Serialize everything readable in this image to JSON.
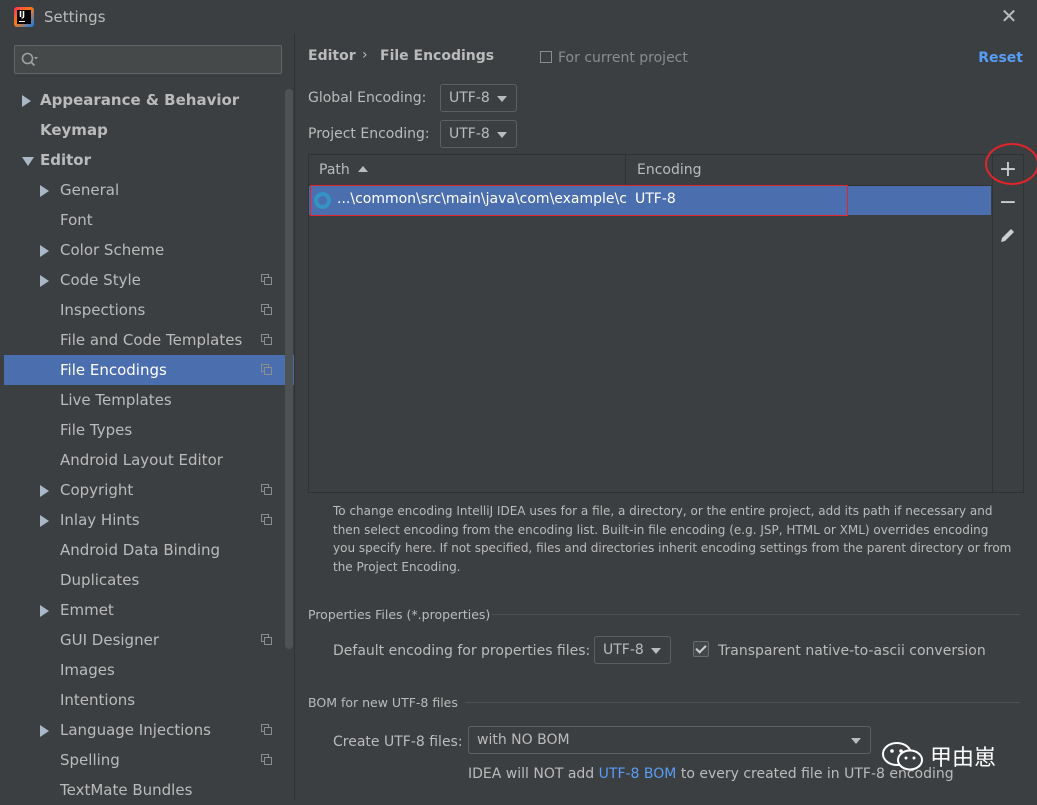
{
  "window": {
    "title": "Settings",
    "close_icon": "close-icon"
  },
  "search": {
    "placeholder": "",
    "value": ""
  },
  "sidebar": {
    "items": [
      {
        "label": "Appearance & Behavior",
        "level": 0,
        "arrow": "right",
        "bold": true
      },
      {
        "label": "Keymap",
        "level": 0,
        "arrow": "none",
        "bold": true
      },
      {
        "label": "Editor",
        "level": 0,
        "arrow": "down",
        "bold": true
      },
      {
        "label": "General",
        "level": 1,
        "arrow": "right"
      },
      {
        "label": "Font",
        "level": 1,
        "arrow": "none"
      },
      {
        "label": "Color Scheme",
        "level": 1,
        "arrow": "right"
      },
      {
        "label": "Code Style",
        "level": 1,
        "arrow": "right",
        "project": true
      },
      {
        "label": "Inspections",
        "level": 1,
        "arrow": "none",
        "project": true
      },
      {
        "label": "File and Code Templates",
        "level": 1,
        "arrow": "none",
        "project": true
      },
      {
        "label": "File Encodings",
        "level": 1,
        "arrow": "none",
        "project": true,
        "selected": true
      },
      {
        "label": "Live Templates",
        "level": 1,
        "arrow": "none"
      },
      {
        "label": "File Types",
        "level": 1,
        "arrow": "none"
      },
      {
        "label": "Android Layout Editor",
        "level": 1,
        "arrow": "none"
      },
      {
        "label": "Copyright",
        "level": 1,
        "arrow": "right",
        "project": true
      },
      {
        "label": "Inlay Hints",
        "level": 1,
        "arrow": "right",
        "project": true
      },
      {
        "label": "Android Data Binding",
        "level": 1,
        "arrow": "none"
      },
      {
        "label": "Duplicates",
        "level": 1,
        "arrow": "none"
      },
      {
        "label": "Emmet",
        "level": 1,
        "arrow": "right"
      },
      {
        "label": "GUI Designer",
        "level": 1,
        "arrow": "none",
        "project": true
      },
      {
        "label": "Images",
        "level": 1,
        "arrow": "none"
      },
      {
        "label": "Intentions",
        "level": 1,
        "arrow": "none"
      },
      {
        "label": "Language Injections",
        "level": 1,
        "arrow": "right",
        "project": true
      },
      {
        "label": "Spelling",
        "level": 1,
        "arrow": "none",
        "project": true
      },
      {
        "label": "TextMate Bundles",
        "level": 1,
        "arrow": "none"
      }
    ]
  },
  "header": {
    "breadcrumb_parent": "Editor",
    "breadcrumb_sep": "›",
    "breadcrumb_current": "File Encodings",
    "scope": "For current project",
    "reset": "Reset"
  },
  "global_encoding": {
    "label": "Global Encoding:",
    "value": "UTF-8"
  },
  "project_encoding": {
    "label": "Project Encoding:",
    "value": "UTF-8"
  },
  "table": {
    "columns": [
      "Path",
      "Encoding"
    ],
    "rows": [
      {
        "path": "...\\common\\src\\main\\java\\com\\example\\cc",
        "encoding": "UTF-8"
      }
    ],
    "tools": {
      "add": "+",
      "remove": "−",
      "edit_icon": "pencil-icon"
    }
  },
  "help_text": "To change encoding IntelliJ IDEA uses for a file, a directory, or the entire project, add its path if necessary and then select encoding from the encoding list. Built-in file encoding (e.g. JSP, HTML or XML) overrides encoding you specify here. If not specified, files and directories inherit encoding settings from the parent directory or from the Project Encoding.",
  "properties": {
    "group_title": "Properties Files (*.properties)",
    "default_label": "Default encoding for properties files:",
    "default_value": "UTF-8",
    "transparent_label": "Transparent native-to-ascii conversion",
    "transparent_checked": true
  },
  "bom": {
    "group_title": "BOM for new UTF-8 files",
    "create_label": "Create UTF-8 files:",
    "create_value": "with NO BOM",
    "note_before": "IDEA will NOT add ",
    "note_link": "UTF-8 BOM",
    "note_after": " to every created file in UTF-8 encoding"
  },
  "watermark": {
    "text": "甲由崽",
    "icon": "wechat-icon"
  },
  "colors": {
    "background": "#3c3f41",
    "selection": "#4b6eaf",
    "link": "#589df6",
    "annotation": "#e0262b"
  }
}
